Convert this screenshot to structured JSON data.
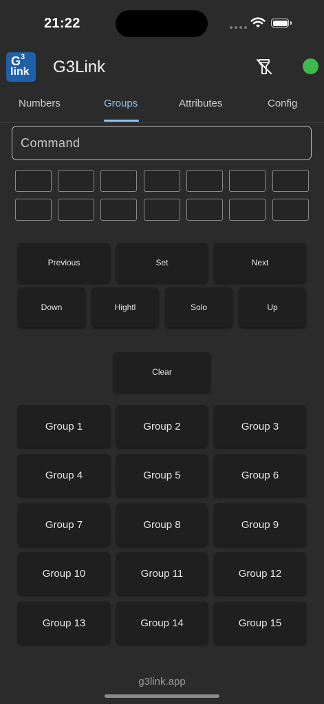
{
  "status_bar": {
    "time": "21:22"
  },
  "app": {
    "logo_g": "G",
    "logo_sup": "3",
    "logo_link": "link",
    "title": "G3Link",
    "connection_color": "#3cb94a"
  },
  "tabs": [
    {
      "label": "Numbers",
      "active": false
    },
    {
      "label": "Groups",
      "active": true
    },
    {
      "label": "Attributes",
      "active": false
    },
    {
      "label": "Config",
      "active": false
    }
  ],
  "command": {
    "placeholder": "Command",
    "value": ""
  },
  "slots_rows": 2,
  "slots_per_row": 7,
  "controls": {
    "previous": "Previous",
    "set": "Set",
    "next": "Next",
    "down": "Down",
    "highlight": "Hightl",
    "solo": "Solo",
    "up": "Up",
    "clear": "Clear"
  },
  "groups": [
    "Group 1",
    "Group 2",
    "Group 3",
    "Group 4",
    "Group 5",
    "Group 6",
    "Group 7",
    "Group 8",
    "Group 9",
    "Group 10",
    "Group 11",
    "Group 12",
    "Group 13",
    "Group 14",
    "Group 15"
  ],
  "footer": {
    "text": "g3link.app"
  },
  "colors": {
    "accent": "#8fc4ef",
    "background": "#2b2b2b",
    "button": "#1f1f1f"
  }
}
